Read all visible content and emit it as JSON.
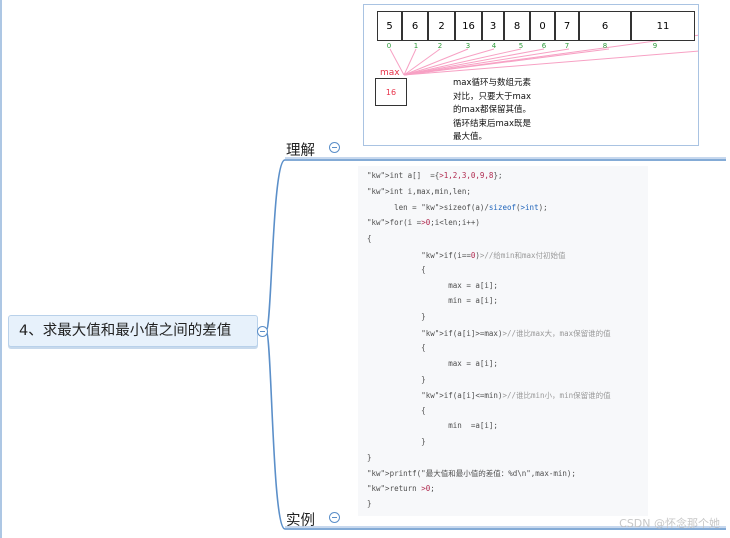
{
  "central_topic": "4、求最大值和最小值之间的差值",
  "branches": [
    {
      "label": "理解"
    },
    {
      "label": "实例"
    }
  ],
  "array_diagram": {
    "values": [
      "5",
      "6",
      "2",
      "16",
      "3",
      "8",
      "0",
      "7",
      "6",
      "11"
    ],
    "indices": [
      "0",
      "1",
      "2",
      "3",
      "4",
      "5",
      "6",
      "7",
      "8",
      "9"
    ],
    "max_label": "max",
    "max_value": "16",
    "note_lines": [
      "max循环与数组元素",
      "对比，只要大于max",
      "的max都保留其值。",
      "循环结束后max既是",
      "最大值。"
    ]
  },
  "code_lines": [
    "int a[]  ={1,2,3,0,9,8};",
    "int i,max,min,len;",
    "      len = sizeof(a)/sizeof(int);",
    "for(i =0;i<len;i++)",
    "{",
    "            if(i==0)//给min和max付初始值",
    "            {",
    "                  max = a[i];",
    "                  min = a[i];",
    "            }",
    "            if(a[i]>=max)//谁比max大，max保留谁的值",
    "            {",
    "                  max = a[i];",
    "            }",
    "            if(a[i]<=min)//谁比min小，min保留谁的值",
    "            {",
    "                  min  =a[i];",
    "            }",
    "}",
    "printf(\"最大值和最小值的差值：%d\\n\",max-min);",
    "return 0;",
    "}"
  ],
  "watermark": "CSDN @怀念那个她",
  "colors": {
    "branch_line": "#5b8fc9",
    "central_fill": "#e7f1fb",
    "code_bg": "#f7f8fa",
    "keyword": "#2266bb",
    "number": "#b02a4f",
    "index_green": "#2e9a3a",
    "max_red": "#e8334a",
    "arrow_pink": "#f7a1c4"
  }
}
